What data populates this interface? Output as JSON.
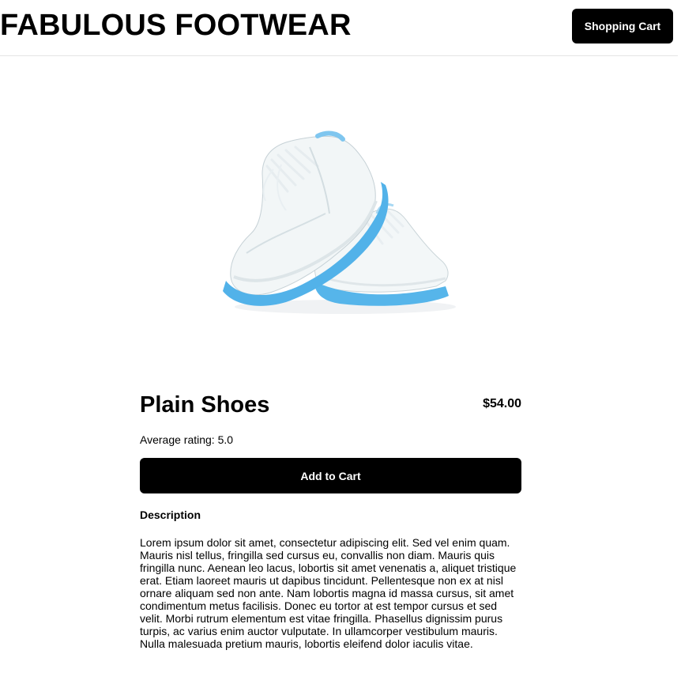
{
  "header": {
    "store_name": "FABULOUS FOOTWEAR",
    "cart_label": "Shopping Cart"
  },
  "product": {
    "image_icon": "sneakers-image",
    "name": "Plain Shoes",
    "price": "$54.00",
    "rating_text": "Average rating: 5.0",
    "add_to_cart_label": "Add to Cart",
    "description_heading": "Description",
    "description": "Lorem ipsum dolor sit amet, consectetur adipiscing elit. Sed vel enim quam. Mauris nisl tellus, fringilla sed cursus eu, convallis non diam. Mauris quis fringilla nunc. Aenean leo lacus, lobortis sit amet venenatis a, aliquet tristique erat. Etiam laoreet mauris ut dapibus tincidunt. Pellentesque non ex at nisl ornare aliquam sed non ante. Nam lobortis magna id massa cursus, sit amet condimentum metus facilisis. Donec eu tortor at est tempor cursus et sed velit. Morbi rutrum elementum est vitae fringilla. Phasellus dignissim purus turpis, ac varius enim auctor vulputate. In ullamcorper vestibulum mauris. Nulla malesuada pretium mauris, lobortis eleifend dolor iaculis vitae."
  },
  "colors": {
    "button_bg": "#000000",
    "button_text": "#ffffff",
    "sole_accent": "#4fb0e8"
  }
}
